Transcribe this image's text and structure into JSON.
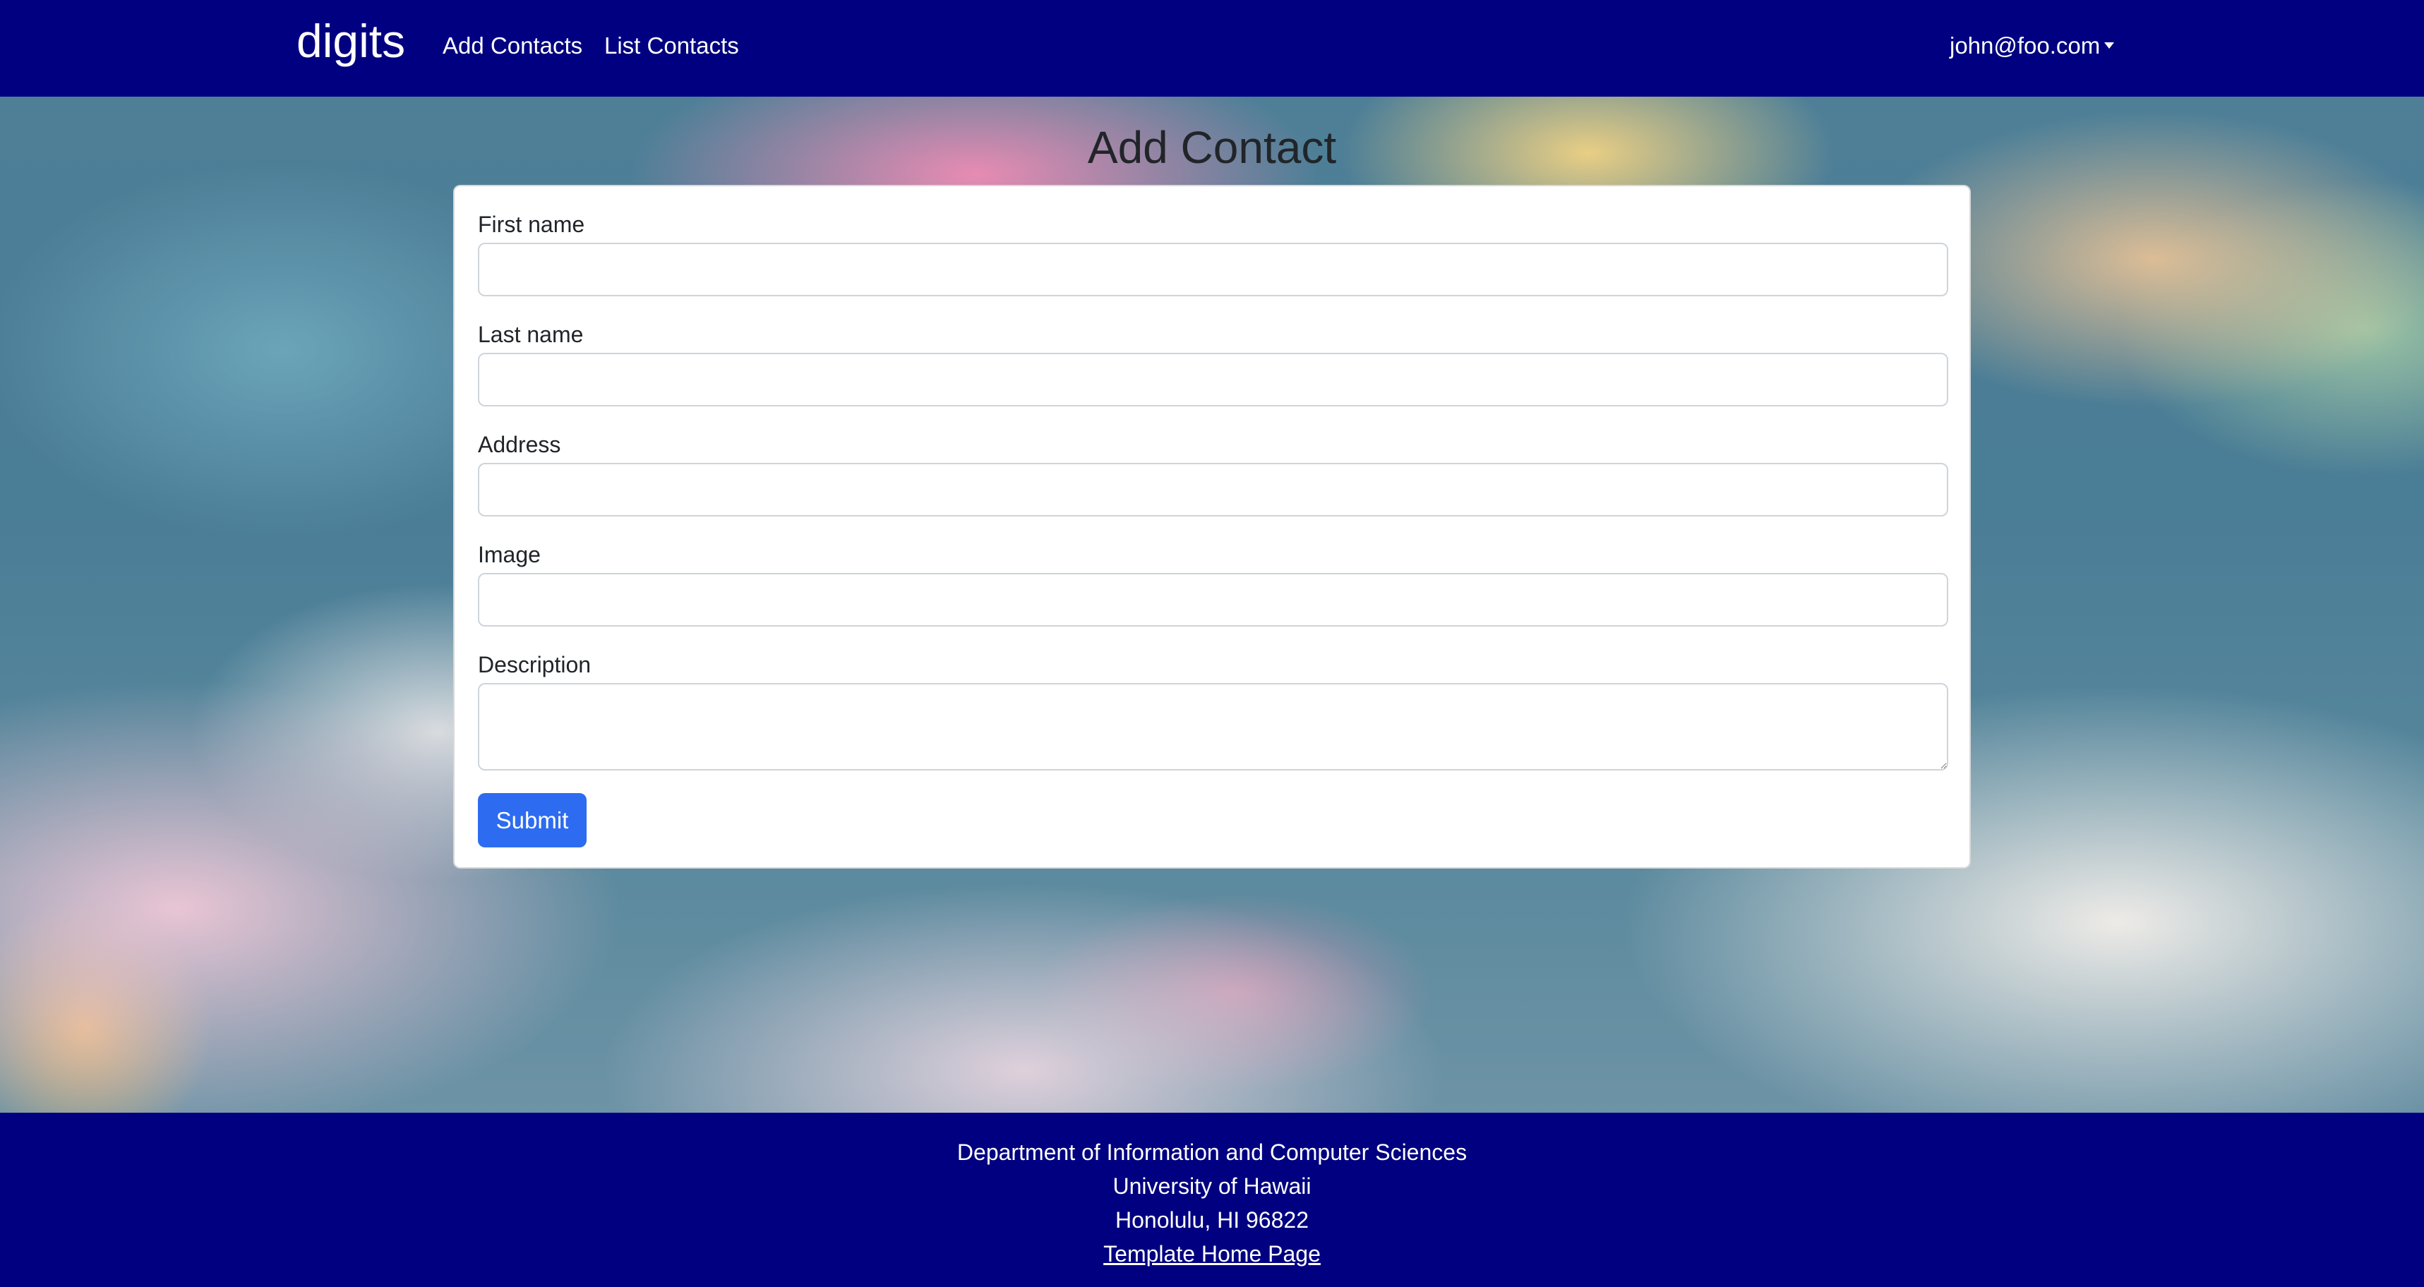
{
  "navbar": {
    "brand": "digits",
    "links": [
      "Add Contacts",
      "List Contacts"
    ],
    "user": "john@foo.com",
    "background_color": "#000080"
  },
  "page": {
    "title": "Add Contact"
  },
  "form": {
    "fields": [
      {
        "label": "First name",
        "value": ""
      },
      {
        "label": "Last name",
        "value": ""
      },
      {
        "label": "Address",
        "value": ""
      },
      {
        "label": "Image",
        "value": ""
      },
      {
        "label": "Description",
        "value": ""
      }
    ],
    "submit_label": "Submit",
    "submit_color": "#2d6cf0"
  },
  "footer": {
    "lines": [
      "Department of Information and Computer Sciences",
      "University of Hawaii",
      "Honolulu, HI 96822"
    ],
    "link": "Template Home Page",
    "background_color": "#000080"
  },
  "icons": {
    "user_menu_caret": "chevron-down-icon"
  }
}
